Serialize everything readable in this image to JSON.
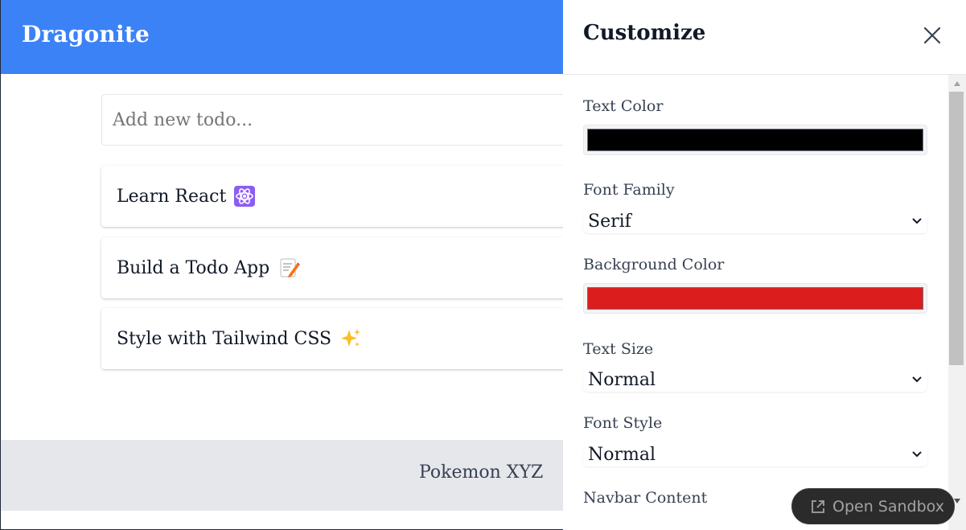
{
  "navbar": {
    "brand": "Dragonite",
    "background": "#3b82f6"
  },
  "todo": {
    "input_placeholder": "Add new todo...",
    "items": [
      {
        "text": "Learn React",
        "icon": "atom-icon"
      },
      {
        "text": "Build a Todo App",
        "icon": "memo-icon"
      },
      {
        "text": "Style with Tailwind CSS",
        "icon": "sparkles-icon"
      }
    ]
  },
  "footer": {
    "text": "Pokemon XYZ"
  },
  "panel": {
    "title": "Customize",
    "close_icon": "close-icon",
    "fields": {
      "text_color": {
        "label": "Text Color",
        "value": "#000000"
      },
      "font_family": {
        "label": "Font Family",
        "value": "Serif"
      },
      "background_color": {
        "label": "Background Color",
        "value": "#dc1d1d"
      },
      "text_size": {
        "label": "Text Size",
        "value": "Normal"
      },
      "font_style": {
        "label": "Font Style",
        "value": "Normal"
      },
      "navbar_content": {
        "label": "Navbar Content"
      }
    }
  },
  "sandbox_button": {
    "label": "Open Sandbox",
    "icon": "external-link-icon"
  }
}
